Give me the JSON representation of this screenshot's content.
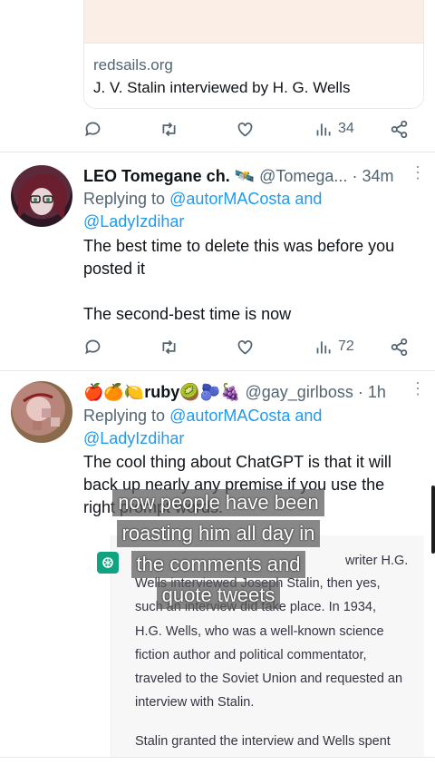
{
  "link_card": {
    "domain": "redsails.org",
    "title": "J. V. Stalin interviewed by H. G. Wells"
  },
  "tweet0_actions": {
    "views": "34"
  },
  "tweet1": {
    "name": "LEO Tomegane ch. 🛰️",
    "handle": "@Tomega...",
    "time": "· 34m",
    "reply_prefix": "Replying to ",
    "reply_user1": "@autorMACosta",
    "reply_and": " and",
    "reply_user2": "@LadyIzdihar",
    "body_line1": "The best time to delete this was before you",
    "body_line2": "posted it",
    "body_line3": "The second-best time is now",
    "views": "72"
  },
  "tweet2": {
    "name": "🍎🍊🍋ruby🥝🫐🍇",
    "handle": "@gay_girlboss",
    "time": "· 1h",
    "reply_prefix": "Replying to ",
    "reply_user1": "@autorMACosta",
    "reply_and": " and",
    "reply_user2": "@LadyIzdihar",
    "body_line1": "The cool thing about ChatGPT is that it will",
    "body_line2": "back up nearly any premise if you use the",
    "body_line3": "right prompt words."
  },
  "screenshot_text": {
    "line1": "writer H.G.",
    "line2": "Wells interviewed Joseph Stalin, then yes,",
    "line3": "such an interview did take place. In 1934,",
    "line4": "H.G. Wells, who was a well-known science",
    "line5": "fiction author and political commentator,",
    "line6": "traveled to the Soviet Union and requested an",
    "line7": "interview with Stalin.",
    "line8": "Stalin granted the interview and Wells spent"
  },
  "caption": {
    "line1": "now people have been",
    "line2": "roasting him all day in",
    "line3": "the comments and",
    "line4": "quote tweets"
  },
  "icons": {
    "reply": "reply-icon",
    "retweet": "retweet-icon",
    "like": "heart-icon",
    "views": "views-icon",
    "share": "share-icon",
    "more": "more-icon"
  },
  "colors": {
    "link": "#1d9bf0",
    "muted": "#536471",
    "text": "#0f1419"
  }
}
